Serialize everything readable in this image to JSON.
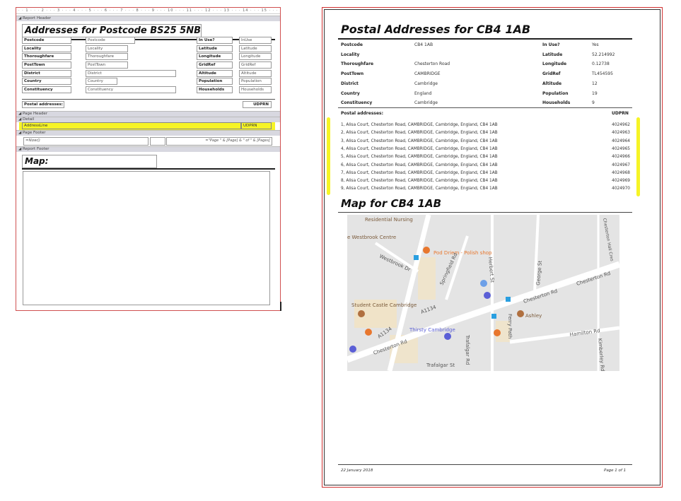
{
  "design": {
    "ruler": "· · 1 · · · 2 · · · 3 · · · 4 · · · 5 · · · 6 · · · 7 · · · 8 · · · 9 · · · 10 · · · 11 · · · 12 · · · 13 · · · 14 · · · 15 · · · 16 · · · 17 · · · 18 · · ·",
    "bands": {
      "report_header": "Report Header",
      "page_header": "Page Header",
      "detail": "Detail",
      "page_footer": "Page Footer",
      "report_footer": "Report Footer"
    },
    "title": "Addresses for Postcode BS25 5NB",
    "left_fields": [
      {
        "label": "Postcode",
        "control": "Postcode"
      },
      {
        "label": "Locality",
        "control": "Locality"
      },
      {
        "label": "Thoroughfare",
        "control": "Thoroughfare"
      },
      {
        "label": "PostTown",
        "control": "PostTown"
      },
      {
        "label": "District",
        "control": "District"
      },
      {
        "label": "Country",
        "control": "Country"
      },
      {
        "label": "Constituency",
        "control": "Constituency"
      }
    ],
    "right_fields": [
      {
        "label": "In Use?",
        "control": "InUse"
      },
      {
        "label": "Latitude",
        "control": "Latitude"
      },
      {
        "label": "Longitude",
        "control": "Longitude"
      },
      {
        "label": "GridRef",
        "control": "GridRef"
      },
      {
        "label": "Altitude",
        "control": "Altitude"
      },
      {
        "label": "Population",
        "control": "Population"
      },
      {
        "label": "Households",
        "control": "Households"
      }
    ],
    "postal_label": "Postal addresses:",
    "udprn_label": "UDPRN",
    "detail_address": "AddressLine",
    "detail_udprn": "UDPRN",
    "footer_now": "=Now()",
    "footer_page": "=\"Page \" & [Page] & \" of \" & [Pages]",
    "map_label": "Map:"
  },
  "report": {
    "title": "Postal Addresses for CB4 1AB",
    "left_fields": [
      {
        "label": "Postcode",
        "value": "CB4 1AB"
      },
      {
        "label": "Locality",
        "value": ""
      },
      {
        "label": "Thoroughfare",
        "value": "Chesterton Road"
      },
      {
        "label": "PostTown",
        "value": "CAMBRIDGE"
      },
      {
        "label": "District",
        "value": "Cambridge"
      },
      {
        "label": "Country",
        "value": "England"
      },
      {
        "label": "Constituency",
        "value": "Cambridge"
      }
    ],
    "right_fields": [
      {
        "label": "In Use?",
        "value": "Yes"
      },
      {
        "label": "Latitude",
        "value": "52.214992"
      },
      {
        "label": "Longitude",
        "value": "0.12738"
      },
      {
        "label": "GridRef",
        "value": "TL454595"
      },
      {
        "label": "Altitude",
        "value": "12"
      },
      {
        "label": "Population",
        "value": "19"
      },
      {
        "label": "Households",
        "value": "9"
      }
    ],
    "postal_label": "Postal addresses:",
    "udprn_label": "UDPRN",
    "addresses": [
      {
        "line": "1, Alisa Court, Chesterton Road, CAMBRIDGE, Cambridge, England, CB4 1AB",
        "udprn": "4024962"
      },
      {
        "line": "2, Alisa Court, Chesterton Road, CAMBRIDGE, Cambridge, England, CB4 1AB",
        "udprn": "4024963"
      },
      {
        "line": "3, Alisa Court, Chesterton Road, CAMBRIDGE, Cambridge, England, CB4 1AB",
        "udprn": "4024964"
      },
      {
        "line": "4, Alisa Court, Chesterton Road, CAMBRIDGE, Cambridge, England, CB4 1AB",
        "udprn": "4024965"
      },
      {
        "line": "5, Alisa Court, Chesterton Road, CAMBRIDGE, Cambridge, England, CB4 1AB",
        "udprn": "4024966"
      },
      {
        "line": "6, Alisa Court, Chesterton Road, CAMBRIDGE, Cambridge, England, CB4 1AB",
        "udprn": "4024967"
      },
      {
        "line": "7, Alisa Court, Chesterton Road, CAMBRIDGE, Cambridge, England, CB4 1AB",
        "udprn": "4024968"
      },
      {
        "line": "8, Alisa Court, Chesterton Road, CAMBRIDGE, Cambridge, England, CB4 1AB",
        "udprn": "4024969"
      },
      {
        "line": "9, Alisa Court, Chesterton Road, CAMBRIDGE, Cambridge, England, CB4 1AB",
        "udprn": "4024970"
      }
    ],
    "map_title": "Map for CB4 1AB",
    "map_labels": {
      "nursing": "Residential Nursing",
      "westbrook": "e Westbrook Centre",
      "westbrook_dr": "Westbrook Dr",
      "pod": "Pod Driem - Polish shop",
      "springfield": "Springfield Rd",
      "herbert": "Herbert St",
      "george": "George St",
      "chesterton_hall": "Chesterton Hall Cres",
      "chesterton1": "Chesterton Rd",
      "chesterton2": "Chesterton Rd",
      "chesterton3": "Chesterton Rd",
      "student": "Student Castle Cambridge",
      "a1134a": "A1134",
      "a1134b": "A1134",
      "ashley": "Ashley",
      "thirsty": "Thirsty Cambridge",
      "trafalgar_rd": "Trafalgar Rd",
      "ferry": "Ferry Path",
      "hamilton": "Hamilton Rd",
      "trafalgar_st": "Trafalgar St",
      "kimberley": "Kimberley Rd"
    },
    "footer_date": "22 January 2018",
    "footer_page": "Page 1 of 1"
  },
  "colors": {
    "highlight": "#f4f200",
    "border_red": "#d03030",
    "map_bg": "#e6e6e6",
    "poi_orange": "#e8772e",
    "poi_blue": "#5b5fd6"
  }
}
